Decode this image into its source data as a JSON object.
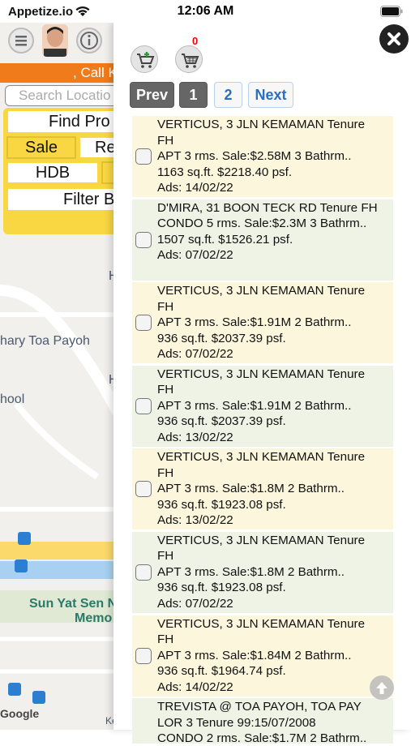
{
  "status": {
    "carrier": "Appetize.io",
    "time": "12:06 AM"
  },
  "left_panel": {
    "call_banner": ", Call K",
    "search_placeholder": "Search Locatio",
    "find_button": "Find Pro",
    "sale_tab": "Sale",
    "rent_tab": "Re",
    "hdb_button": "HDB",
    "filter_button": "Filter B"
  },
  "map": {
    "labels": [
      "hary Toa Payoh",
      "hool",
      "Sun Yat Sen N",
      "Memo",
      "H",
      "H",
      "Ke",
      "Google"
    ]
  },
  "cart": {
    "count": "0"
  },
  "pagination": {
    "prev": "Prev",
    "page1": "1",
    "page2": "2",
    "next": "Next"
  },
  "listings": [
    {
      "l1": "VERTICUS, 3 JLN KEMAMAN Tenure",
      "l2": "FH",
      "l3": "APT 3 rms. Sale:$2.58M 3 Bathrm..",
      "l4": "1163 sq.ft. $2218.40 psf.",
      "l5": "Ads: 14/02/22"
    },
    {
      "l1": "D'MIRA, 31 BOON TECK RD Tenure FH",
      "l2": "CONDO 5 rms. Sale:$2.3M 3 Bathrm..",
      "l3": "1507 sq.ft. $1526.21 psf.",
      "l4": "Ads: 07/02/22",
      "l5": ""
    },
    {
      "l1": "VERTICUS, 3 JLN KEMAMAN Tenure",
      "l2": "FH",
      "l3": "APT 3 rms. Sale:$1.91M 2 Bathrm..",
      "l4": "936 sq.ft. $2037.39 psf.",
      "l5": "Ads: 07/02/22"
    },
    {
      "l1": "VERTICUS, 3 JLN KEMAMAN Tenure",
      "l2": "FH",
      "l3": "APT 3 rms. Sale:$1.91M 2 Bathrm..",
      "l4": "936 sq.ft. $2037.39 psf.",
      "l5": "Ads: 13/02/22"
    },
    {
      "l1": "VERTICUS, 3 JLN KEMAMAN Tenure",
      "l2": "FH",
      "l3": "APT 3 rms. Sale:$1.8M 2 Bathrm..",
      "l4": "936 sq.ft. $1923.08 psf.",
      "l5": "Ads: 13/02/22"
    },
    {
      "l1": "VERTICUS, 3 JLN KEMAMAN Tenure",
      "l2": "FH",
      "l3": "APT 3 rms. Sale:$1.8M 2 Bathrm..",
      "l4": "936 sq.ft. $1923.08 psf.",
      "l5": "Ads: 07/02/22"
    },
    {
      "l1": "VERTICUS, 3 JLN KEMAMAN Tenure",
      "l2": "FH",
      "l3": "APT 3 rms. Sale:$1.84M 2 Bathrm..",
      "l4": "936 sq.ft. $1964.74 psf.",
      "l5": "Ads: 14/02/22"
    },
    {
      "l1": "TREVISTA @ TOA PAYOH, TOA PAY",
      "l2": "LOR 3 Tenure 99:15/07/2008",
      "l3": "CONDO 2 rms. Sale:$1.7M 2 Bathrm..",
      "l4": "",
      "l5": ""
    }
  ],
  "colors": {
    "accent_orange": "#f07b1a",
    "accent_yellow": "#f8d742",
    "link_blue": "#2a6fc0"
  }
}
